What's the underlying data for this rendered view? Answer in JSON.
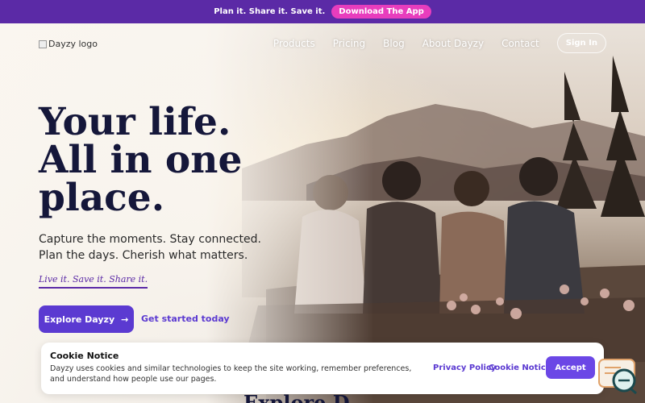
{
  "topbar": {
    "text": "Plan it. Share it. Save it.",
    "cta_label": "Download The App",
    "bg_color": "#5b2aa6",
    "cta_color": "#e83dbd"
  },
  "nav": {
    "logo_alt": "Dayzy logo",
    "links": [
      "Products",
      "Pricing",
      "Blog",
      "About Dayzy",
      "Contact"
    ],
    "signin_label": "Sign In"
  },
  "hero": {
    "headline_lines": [
      "Your life.",
      "All in one",
      "place."
    ],
    "subhead_lines": [
      "Capture the moments. Stay connected.",
      "Plan the days. Cherish what matters."
    ],
    "tagline": "Live it. Save it. Share it.",
    "primary_cta": "Explore Dayzy",
    "primary_cta_icon": "arrow-right-icon",
    "secondary_cta": "Get started today"
  },
  "cookie_notice": {
    "title": "Cookie Notice",
    "body": "Dayzy uses cookies and similar technologies to keep the site working, remember preferences, and understand how people use our pages.",
    "privacy_link": "Privacy Policy",
    "cookie_link": "Cookie Notice",
    "accept_label": "Accept"
  },
  "peek_heading": "Explore D",
  "colors": {
    "accent": "#5b3ad1",
    "heading": "#15173a"
  }
}
